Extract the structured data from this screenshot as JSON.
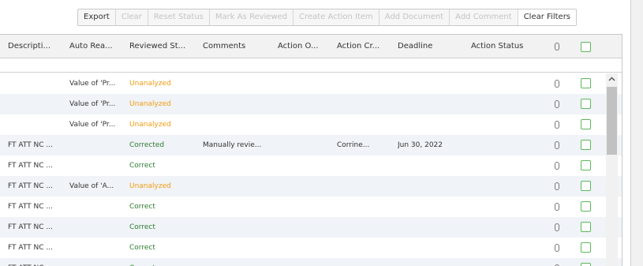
{
  "toolbar": {
    "buttons": [
      {
        "label": "Export",
        "state": "enabled"
      },
      {
        "label": "Clear",
        "state": "disabled"
      },
      {
        "label": "Reset Status",
        "state": "disabled"
      },
      {
        "label": "Mark As Reviewed",
        "state": "disabled"
      },
      {
        "label": "Create Action Item",
        "state": "disabled"
      },
      {
        "label": "Add Document",
        "state": "disabled"
      },
      {
        "label": "Add Comment",
        "state": "disabled"
      },
      {
        "label": "Clear Filters",
        "state": "enabled"
      }
    ]
  },
  "grid": {
    "columns": [
      "Descripti...",
      "Auto Rea...",
      "Reviewed St...",
      "Comments",
      "Action O...",
      "Action Cr...",
      "Deadline",
      "Action Status"
    ],
    "header_icons": [
      "paperclip-icon",
      "checkbox"
    ],
    "rows": [
      {
        "description": "",
        "auto_reason": "Value of 'Pr...",
        "reviewed_status": "Unanalyzed",
        "status_class": "unanalyzed",
        "comments": "",
        "action_owner": "",
        "action_created": "",
        "deadline": "",
        "action_status": ""
      },
      {
        "description": "",
        "auto_reason": "Value of 'Pr...",
        "reviewed_status": "Unanalyzed",
        "status_class": "unanalyzed",
        "comments": "",
        "action_owner": "",
        "action_created": "",
        "deadline": "",
        "action_status": ""
      },
      {
        "description": "",
        "auto_reason": "Value of 'Pr...",
        "reviewed_status": "Unanalyzed",
        "status_class": "unanalyzed",
        "comments": "",
        "action_owner": "",
        "action_created": "",
        "deadline": "",
        "action_status": ""
      },
      {
        "description": "FT ATT NC ...",
        "auto_reason": "",
        "reviewed_status": "Corrected",
        "status_class": "correct",
        "comments": "Manually revie...",
        "action_owner": "",
        "action_created": "Corrine...",
        "deadline": "Jun 30, 2022",
        "action_status": ""
      },
      {
        "description": "FT ATT NC ...",
        "auto_reason": "",
        "reviewed_status": "Correct",
        "status_class": "correct",
        "comments": "",
        "action_owner": "",
        "action_created": "",
        "deadline": "",
        "action_status": ""
      },
      {
        "description": "FT ATT NC ...",
        "auto_reason": "Value of 'A...",
        "reviewed_status": "Unanalyzed",
        "status_class": "unanalyzed",
        "comments": "",
        "action_owner": "",
        "action_created": "",
        "deadline": "",
        "action_status": ""
      },
      {
        "description": "FT ATT NC ...",
        "auto_reason": "",
        "reviewed_status": "Correct",
        "status_class": "correct",
        "comments": "",
        "action_owner": "",
        "action_created": "",
        "deadline": "",
        "action_status": ""
      },
      {
        "description": "FT ATT NC ...",
        "auto_reason": "",
        "reviewed_status": "Correct",
        "status_class": "correct",
        "comments": "",
        "action_owner": "",
        "action_created": "",
        "deadline": "",
        "action_status": ""
      },
      {
        "description": "FT ATT NC ...",
        "auto_reason": "",
        "reviewed_status": "Correct",
        "status_class": "correct",
        "comments": "",
        "action_owner": "",
        "action_created": "",
        "deadline": "",
        "action_status": ""
      },
      {
        "description": "FT ATT NC ...",
        "auto_reason": "",
        "reviewed_status": "Correct",
        "status_class": "correct",
        "comments": "",
        "action_owner": "",
        "action_created": "",
        "deadline": "",
        "action_status": ""
      }
    ]
  },
  "colors": {
    "unanalyzed": "#f39c12",
    "correct": "#2e7d32",
    "checkbox_border": "#5cb85c",
    "row_alt": "#f0f3f7"
  }
}
